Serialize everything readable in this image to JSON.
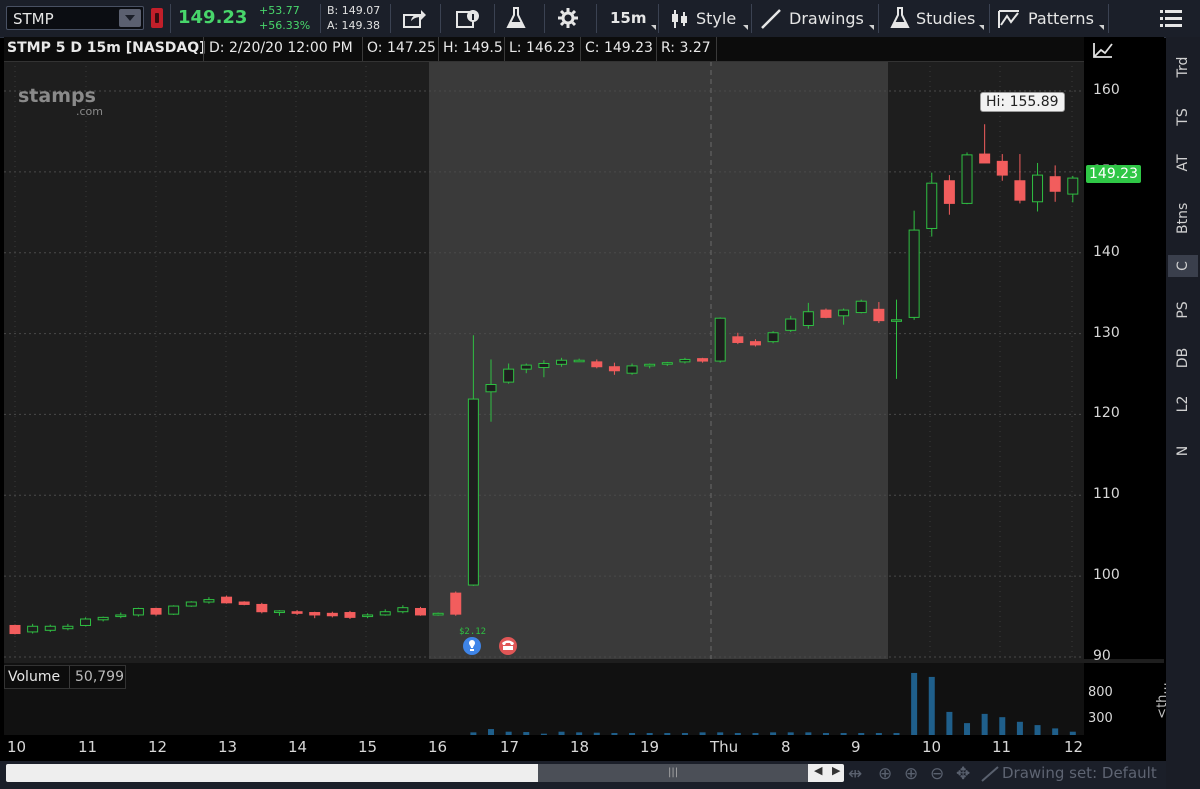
{
  "toolbar": {
    "symbol": "STMP",
    "last": "149.23",
    "net_change": "+53.77",
    "pct_change": "+56.33%",
    "bid": "B: 149.07",
    "ask": "A: 149.38",
    "timeframe": "15m",
    "style": "Style",
    "drawings": "Drawings",
    "studies": "Studies",
    "patterns": "Patterns"
  },
  "header": {
    "title": "STMP 5 D 15m [NASDAQ]",
    "date": "D: 2/20/20 12:00 PM",
    "open": "O: 147.25",
    "high": "H: 149.5",
    "low": "L: 146.23",
    "close": "C: 149.23",
    "range": "R: 3.27"
  },
  "watermark": {
    "line1": "stamps",
    "line2": ".com"
  },
  "callout": {
    "high": "Hi: 155.89"
  },
  "price_tag": "149.23",
  "event_label": "$2.12",
  "right_tabs": [
    "Trd",
    "TS",
    "AT",
    "Btns",
    "C",
    "PS",
    "DB",
    "L2",
    "N"
  ],
  "volume": {
    "label": "Volume",
    "value": "50,799",
    "ticks": [
      "800",
      "300"
    ],
    "collapse": "<th..."
  },
  "drawing_set": "Drawing set: Default",
  "colors": {
    "up": "#2fbf42",
    "down": "#f25d5d",
    "last": "#2fc746",
    "bg_dark": "#1e1e1e",
    "bg_light": "#3a3a3a"
  },
  "chart_data": {
    "type": "candlestick",
    "y_ticks": [
      160,
      150,
      140,
      130,
      120,
      110,
      100,
      90
    ],
    "ylim": [
      90,
      162
    ],
    "x_ticks": [
      "10",
      "11",
      "12",
      "13",
      "14",
      "15",
      "16",
      "17",
      "18",
      "19",
      "Thu",
      "8",
      "9",
      "10",
      "11",
      "12"
    ],
    "candles": [
      {
        "o": 93.9,
        "h": 94.0,
        "l": 92.8,
        "c": 92.9
      },
      {
        "o": 93.1,
        "h": 94.1,
        "l": 92.9,
        "c": 93.8
      },
      {
        "o": 93.3,
        "h": 94.0,
        "l": 93.1,
        "c": 93.8
      },
      {
        "o": 93.5,
        "h": 94.1,
        "l": 93.3,
        "c": 93.8
      },
      {
        "o": 93.9,
        "h": 94.9,
        "l": 93.8,
        "c": 94.7
      },
      {
        "o": 94.6,
        "h": 95.0,
        "l": 94.4,
        "c": 94.9
      },
      {
        "o": 95.0,
        "h": 95.5,
        "l": 94.8,
        "c": 95.2
      },
      {
        "o": 95.2,
        "h": 96.1,
        "l": 95.0,
        "c": 96.0
      },
      {
        "o": 96.0,
        "h": 96.1,
        "l": 95.1,
        "c": 95.3
      },
      {
        "o": 95.3,
        "h": 96.4,
        "l": 95.2,
        "c": 96.3
      },
      {
        "o": 96.3,
        "h": 96.9,
        "l": 96.2,
        "c": 96.8
      },
      {
        "o": 96.8,
        "h": 97.4,
        "l": 96.6,
        "c": 97.1
      },
      {
        "o": 97.4,
        "h": 97.6,
        "l": 96.6,
        "c": 96.7
      },
      {
        "o": 96.8,
        "h": 96.9,
        "l": 96.4,
        "c": 96.5
      },
      {
        "o": 96.5,
        "h": 96.7,
        "l": 95.4,
        "c": 95.6
      },
      {
        "o": 95.5,
        "h": 95.8,
        "l": 95.1,
        "c": 95.7
      },
      {
        "o": 95.6,
        "h": 95.8,
        "l": 95.2,
        "c": 95.4
      },
      {
        "o": 95.5,
        "h": 95.6,
        "l": 94.8,
        "c": 95.2
      },
      {
        "o": 95.4,
        "h": 95.6,
        "l": 94.9,
        "c": 95.1
      },
      {
        "o": 95.5,
        "h": 95.7,
        "l": 94.7,
        "c": 94.9
      },
      {
        "o": 95.0,
        "h": 95.4,
        "l": 94.8,
        "c": 95.2
      },
      {
        "o": 95.2,
        "h": 95.9,
        "l": 95.1,
        "c": 95.6
      },
      {
        "o": 95.6,
        "h": 96.4,
        "l": 95.4,
        "c": 96.1
      },
      {
        "o": 96.0,
        "h": 96.2,
        "l": 95.1,
        "c": 95.2
      },
      {
        "o": 95.2,
        "h": 95.5,
        "l": 95.1,
        "c": 95.4
      },
      {
        "o": 97.9,
        "h": 98.1,
        "l": 95.1,
        "c": 95.3
      },
      {
        "o": 98.9,
        "h": 129.8,
        "l": 98.8,
        "c": 121.9
      },
      {
        "o": 122.8,
        "h": 126.8,
        "l": 119.1,
        "c": 123.7
      },
      {
        "o": 124.0,
        "h": 126.3,
        "l": 123.8,
        "c": 125.6
      },
      {
        "o": 125.6,
        "h": 126.3,
        "l": 125.1,
        "c": 126.1
      },
      {
        "o": 125.8,
        "h": 126.7,
        "l": 124.6,
        "c": 126.3
      },
      {
        "o": 126.2,
        "h": 127.0,
        "l": 125.9,
        "c": 126.7
      },
      {
        "o": 126.6,
        "h": 126.9,
        "l": 126.5,
        "c": 126.7
      },
      {
        "o": 126.5,
        "h": 126.8,
        "l": 125.7,
        "c": 125.9
      },
      {
        "o": 125.9,
        "h": 126.4,
        "l": 124.9,
        "c": 125.4
      },
      {
        "o": 125.1,
        "h": 126.3,
        "l": 124.9,
        "c": 126.0
      },
      {
        "o": 126.0,
        "h": 126.3,
        "l": 125.7,
        "c": 126.2
      },
      {
        "o": 126.3,
        "h": 126.5,
        "l": 126.0,
        "c": 126.4
      },
      {
        "o": 126.5,
        "h": 127.0,
        "l": 126.3,
        "c": 126.8
      },
      {
        "o": 126.9,
        "h": 127.0,
        "l": 126.4,
        "c": 126.6
      },
      {
        "o": 126.6,
        "h": 132.0,
        "l": 126.4,
        "c": 131.9
      },
      {
        "o": 129.6,
        "h": 130.1,
        "l": 128.7,
        "c": 128.9
      },
      {
        "o": 129.0,
        "h": 129.3,
        "l": 128.4,
        "c": 128.6
      },
      {
        "o": 129.0,
        "h": 130.3,
        "l": 128.8,
        "c": 130.1
      },
      {
        "o": 130.4,
        "h": 132.2,
        "l": 130.2,
        "c": 131.8
      },
      {
        "o": 131.0,
        "h": 133.8,
        "l": 130.6,
        "c": 132.7
      },
      {
        "o": 132.9,
        "h": 133.1,
        "l": 131.9,
        "c": 132.0
      },
      {
        "o": 132.2,
        "h": 133.1,
        "l": 131.1,
        "c": 132.9
      },
      {
        "o": 132.6,
        "h": 134.2,
        "l": 132.5,
        "c": 134.0
      },
      {
        "o": 133.0,
        "h": 133.9,
        "l": 131.3,
        "c": 131.6
      },
      {
        "o": 131.6,
        "h": 134.2,
        "l": 124.4,
        "c": 131.7
      },
      {
        "o": 132.0,
        "h": 145.2,
        "l": 131.7,
        "c": 142.8
      },
      {
        "o": 143.0,
        "h": 149.9,
        "l": 142.0,
        "c": 148.6
      },
      {
        "o": 148.9,
        "h": 149.6,
        "l": 144.7,
        "c": 146.1
      },
      {
        "o": 146.1,
        "h": 152.4,
        "l": 146.0,
        "c": 152.1
      },
      {
        "o": 152.2,
        "h": 155.89,
        "l": 151.1,
        "c": 151.1
      },
      {
        "o": 151.3,
        "h": 152.2,
        "l": 148.9,
        "c": 149.6
      },
      {
        "o": 148.9,
        "h": 152.2,
        "l": 146.1,
        "c": 146.5
      },
      {
        "o": 146.3,
        "h": 151.1,
        "l": 145.1,
        "c": 149.6
      },
      {
        "o": 149.4,
        "h": 150.8,
        "l": 146.3,
        "c": 147.6
      },
      {
        "o": 147.25,
        "h": 149.5,
        "l": 146.23,
        "c": 149.23
      }
    ],
    "volume": [
      0,
      0,
      0,
      0,
      0,
      0,
      0,
      0,
      0,
      0,
      0,
      0,
      0,
      0,
      0,
      0,
      0,
      0,
      0,
      0,
      0,
      0,
      0,
      0,
      0,
      0,
      40,
      90,
      50,
      45,
      20,
      50,
      40,
      35,
      30,
      30,
      30,
      30,
      30,
      40,
      40,
      30,
      30,
      40,
      40,
      40,
      30,
      30,
      30,
      30,
      30,
      940,
      880,
      350,
      180,
      320,
      270,
      200,
      150,
      100,
      50
    ]
  }
}
